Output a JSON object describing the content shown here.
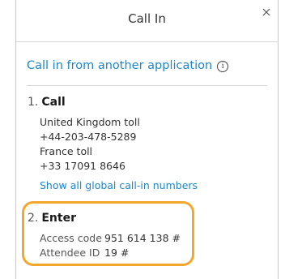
{
  "dialog": {
    "title": "Call In",
    "close_glyph": "×"
  },
  "callin_link": {
    "label": "Call in from another application",
    "info_icon": "info-icon"
  },
  "step1": {
    "number": "1.",
    "label": "Call",
    "lines": [
      "United Kingdom toll",
      "+44-203-478-5289",
      "France toll",
      "+33 17091 8646"
    ],
    "show_all_label": "Show all global call-in numbers"
  },
  "step2": {
    "number": "2.",
    "label": "Enter",
    "access_code_label": "Access code",
    "access_code_value": "951 614 138 #",
    "attendee_id_label": "Attendee ID",
    "attendee_id_value": "19 #"
  },
  "colors": {
    "link": "#1f86c9",
    "highlight": "#f3a72c"
  }
}
